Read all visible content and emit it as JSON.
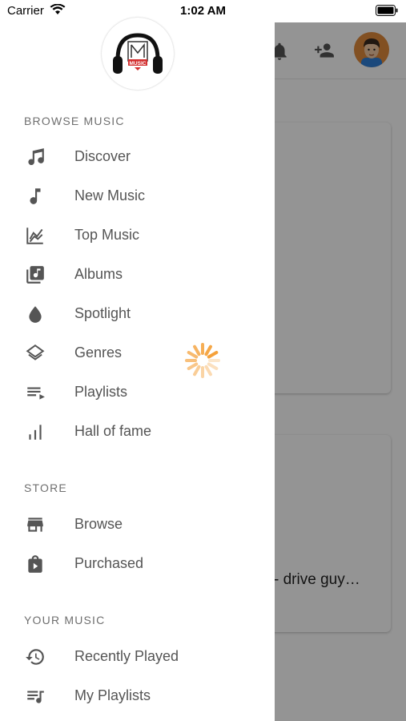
{
  "status_bar": {
    "carrier": "Carrier",
    "time": "1:02 AM"
  },
  "logo": {
    "name": "music-logo",
    "text": "MUSIC"
  },
  "drawer": {
    "sections": [
      {
        "title": "BROWSE MUSIC",
        "items": [
          {
            "label": "Discover",
            "icon": "music-notes-icon"
          },
          {
            "label": "New Music",
            "icon": "music-note-icon"
          },
          {
            "label": "Top Music",
            "icon": "trending-chart-icon"
          },
          {
            "label": "Albums",
            "icon": "album-library-icon"
          },
          {
            "label": "Spotlight",
            "icon": "drop-icon"
          },
          {
            "label": "Genres",
            "icon": "layers-icon"
          },
          {
            "label": "Playlists",
            "icon": "playlist-play-icon"
          },
          {
            "label": "Hall of fame",
            "icon": "bar-chart-icon"
          }
        ]
      },
      {
        "title": "STORE",
        "items": [
          {
            "label": "Browse",
            "icon": "store-icon"
          },
          {
            "label": "Purchased",
            "icon": "shopping-bag-icon"
          }
        ]
      },
      {
        "title": "YOUR MUSIC",
        "items": [
          {
            "label": "Recently Played",
            "icon": "history-icon"
          },
          {
            "label": "My Playlists",
            "icon": "playlist-music-icon"
          }
        ]
      }
    ]
  },
  "background": {
    "card_text": "- drive guy…"
  },
  "colors": {
    "spinner": "#f5a13a",
    "icon": "#555555",
    "section_title": "#6f6f6f"
  }
}
